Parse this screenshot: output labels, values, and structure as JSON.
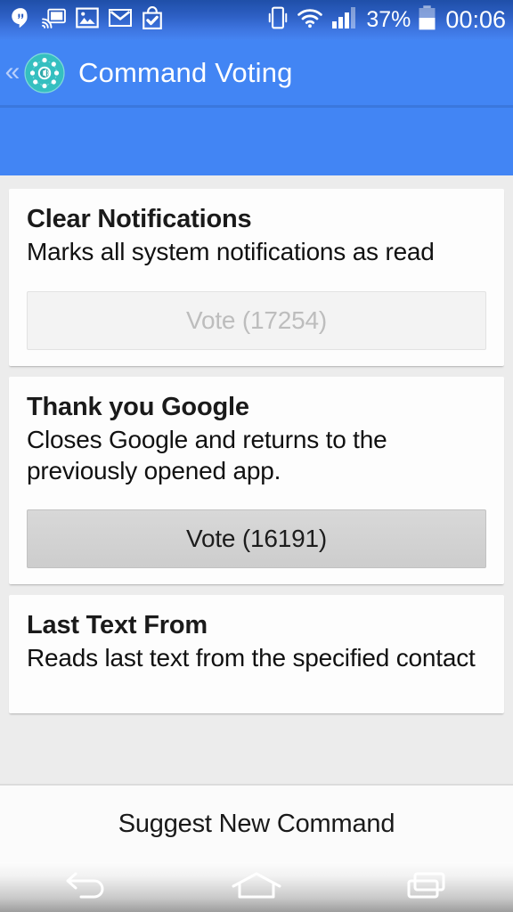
{
  "status_bar": {
    "left_icons": [
      {
        "name": "hangouts-icon",
        "label": "Hangouts"
      },
      {
        "name": "cast-icon",
        "label": "Cast"
      },
      {
        "name": "photos-icon",
        "label": "Photos"
      },
      {
        "name": "gmail-icon",
        "label": "Gmail"
      },
      {
        "name": "play-store-icon",
        "label": "Play Store"
      }
    ],
    "right_icons": [
      {
        "name": "vibrate-icon",
        "label": "Vibrate"
      },
      {
        "name": "wifi-icon",
        "label": "Wi-Fi"
      },
      {
        "name": "cellular-signal-icon",
        "label": "Signal"
      }
    ],
    "battery_percent": "37%",
    "clock": "00:06"
  },
  "action_bar": {
    "back_chevron": "«",
    "app_icon_name": "command-voting-app-icon",
    "title": "Command Voting"
  },
  "commands": [
    {
      "title": "Clear Notifications",
      "description": "Marks all system notifications as read",
      "vote_label": "Vote (17254)",
      "vote_count": 17254,
      "vote_enabled": false
    },
    {
      "title": "Thank you Google",
      "description": "Closes Google and returns to the previously opened app.",
      "vote_label": "Vote (16191)",
      "vote_count": 16191,
      "vote_enabled": true
    },
    {
      "title": "Last Text From",
      "description": "Reads last text from the specified contact",
      "vote_label": "",
      "vote_count": null,
      "vote_enabled": null
    }
  ],
  "footer": {
    "suggest_label": "Suggest New Command"
  },
  "nav_bar": {
    "back": "back-nav-icon",
    "home": "home-nav-icon",
    "recents": "recents-nav-icon"
  },
  "colors": {
    "accent_blue": "#4285F4",
    "status_bar_blue": "#2d5fc4",
    "page_background": "#ECECEC",
    "card_background": "#FDFDFD",
    "app_icon_teal": "#35BFC0"
  }
}
